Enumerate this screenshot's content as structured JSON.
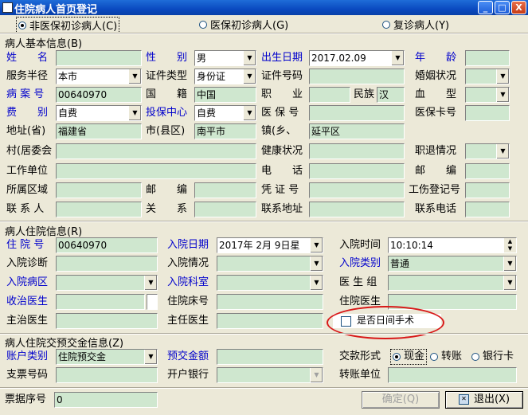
{
  "window": {
    "title": "住院病人首页登记",
    "btn_min": "_",
    "btn_max": "□",
    "btn_close": "X"
  },
  "patient_type": {
    "option1": "非医保初诊病人(C)",
    "option2": "医保初诊病人(G)",
    "option3": "复诊病人(Y)"
  },
  "basic": {
    "group_title": "病人基本信息(B)",
    "name_label": "姓　　名",
    "name_value": "",
    "sex_label": "性　　别",
    "sex_value": "男",
    "birth_label": "出生日期",
    "birth_value": "2017.02.09",
    "age_label": "年　　龄",
    "age_value": "",
    "area_label": "服务半径",
    "area_value": "本市",
    "idtype_label": "证件类型",
    "idtype_value": "身份证",
    "idno_label": "证件号码",
    "idno_value": "",
    "marriage_label": "婚姻状况",
    "marriage_value": "",
    "caseno_label": "病 案 号",
    "caseno_value": "00640970",
    "nation_label": "国　　籍",
    "nation_value": "中国",
    "job_label": "职　　业",
    "job_value": "",
    "ethnic_label": "民族",
    "ethnic_value": "汉",
    "blood_label": "血　　型",
    "blood_value": "",
    "fee_label": "费　　别",
    "fee_value": "自费",
    "insure_label": "投保中心",
    "insure_value": "自费",
    "medno_label": "医 保 号",
    "medno_value": "",
    "medcard_label": "医保卡号",
    "medcard_value": "",
    "prov_label": "地址(省)",
    "prov_value": "福建省",
    "city_label": "市(县区)",
    "city_value": "南平市",
    "town_label": "镇(乡、",
    "town_value": "延平区",
    "village_label": "村(居委会",
    "village_value": "",
    "health_label": "健康状况",
    "health_value": "",
    "retire_label": "职退情况",
    "retire_value": "",
    "work_label": "工作单位",
    "work_value": "",
    "phone_label": "电　　话",
    "phone_value": "",
    "zip_label": "邮　　编",
    "zip_value": "",
    "region_label": "所属区域",
    "region_value": "",
    "zip2_label": "邮　　编",
    "zip2_value": "",
    "cert_label": "凭 证 号",
    "cert_value": "",
    "injury_label": "工伤登记号",
    "injury_value": "",
    "contact_label": "联 系 人",
    "contact_value": "",
    "relation_label": "关　　系",
    "relation_value": "",
    "caddr_label": "联系地址",
    "caddr_value": "",
    "cphone_label": "联系电话",
    "cphone_value": ""
  },
  "inpatient": {
    "group_title": "病人住院信息(R)",
    "inno_label": "住 院 号",
    "inno_value": "00640970",
    "indate_label": "入院日期",
    "indate_value": "2017年 2月 9日星",
    "intime_label": "入院时间",
    "intime_value": "10:10:14",
    "diag_label": "入院诊断",
    "diag_value": "",
    "situ_label": "入院情况",
    "situ_value": "",
    "cat_label": "入院类别",
    "cat_value": "普通",
    "ward_label": "入院病区",
    "ward_value": "",
    "dept_label": "入院科室",
    "dept_value": "",
    "team_label": "医 生 组",
    "team_value": "",
    "recv_label": "收治医生",
    "recv_value": "",
    "bed_label": "住院床号",
    "bed_value": "",
    "hdoc_label": "住院医生",
    "hdoc_value": "",
    "main_label": "主治医生",
    "main_value": "",
    "chief_label": "主任医生",
    "chief_value": "",
    "daysurg_label": "是否日间手术"
  },
  "deposit": {
    "group_title": "病人住院交预交金信息(Z)",
    "acct_label": "账户类别",
    "acct_value": "住院预交金",
    "amount_label": "预交金额",
    "amount_value": "",
    "pay_label": "交款形式",
    "pay_cash": "现金",
    "pay_transfer": "转账",
    "pay_bank": "银行卡",
    "check_label": "支票号码",
    "check_value": "",
    "bank_label": "开户银行",
    "bank_value": "",
    "unit_label": "转账单位",
    "unit_value": ""
  },
  "footer": {
    "receipt_label": "票据序号",
    "receipt_value": "0",
    "ok_label": "确定(Q)",
    "exit_label": "退出(X)"
  }
}
